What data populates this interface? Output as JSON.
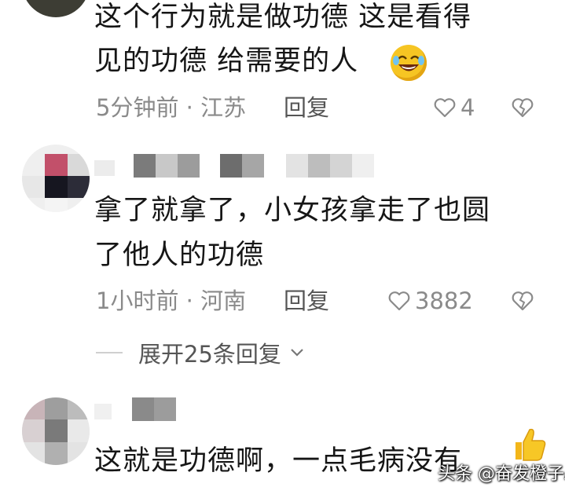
{
  "comments": [
    {
      "text_line1": "这个行为就是做功德  这是看得",
      "text_line2": "见的功德 给需要的人",
      "time": "5分钟前",
      "location": "江苏",
      "reply_label": "回复",
      "likes": "4",
      "emoji": "rolling-on-floor-laughing"
    },
    {
      "text_line1": "拿了就拿了，小女孩拿走了也圆",
      "text_line2": "了他人的功德",
      "time": "1小时前",
      "location": "河南",
      "reply_label": "回复",
      "likes": "3882",
      "expand_label": "展开25条回复"
    },
    {
      "text_line1": "这就是功德啊，一点毛病没有",
      "emoji": "thumbs-up"
    }
  ],
  "separator": "·",
  "watermark": "头条 @奋发橙子A",
  "colors": {
    "text": "#161616",
    "meta": "#8a8a8a",
    "reply": "#555555"
  }
}
